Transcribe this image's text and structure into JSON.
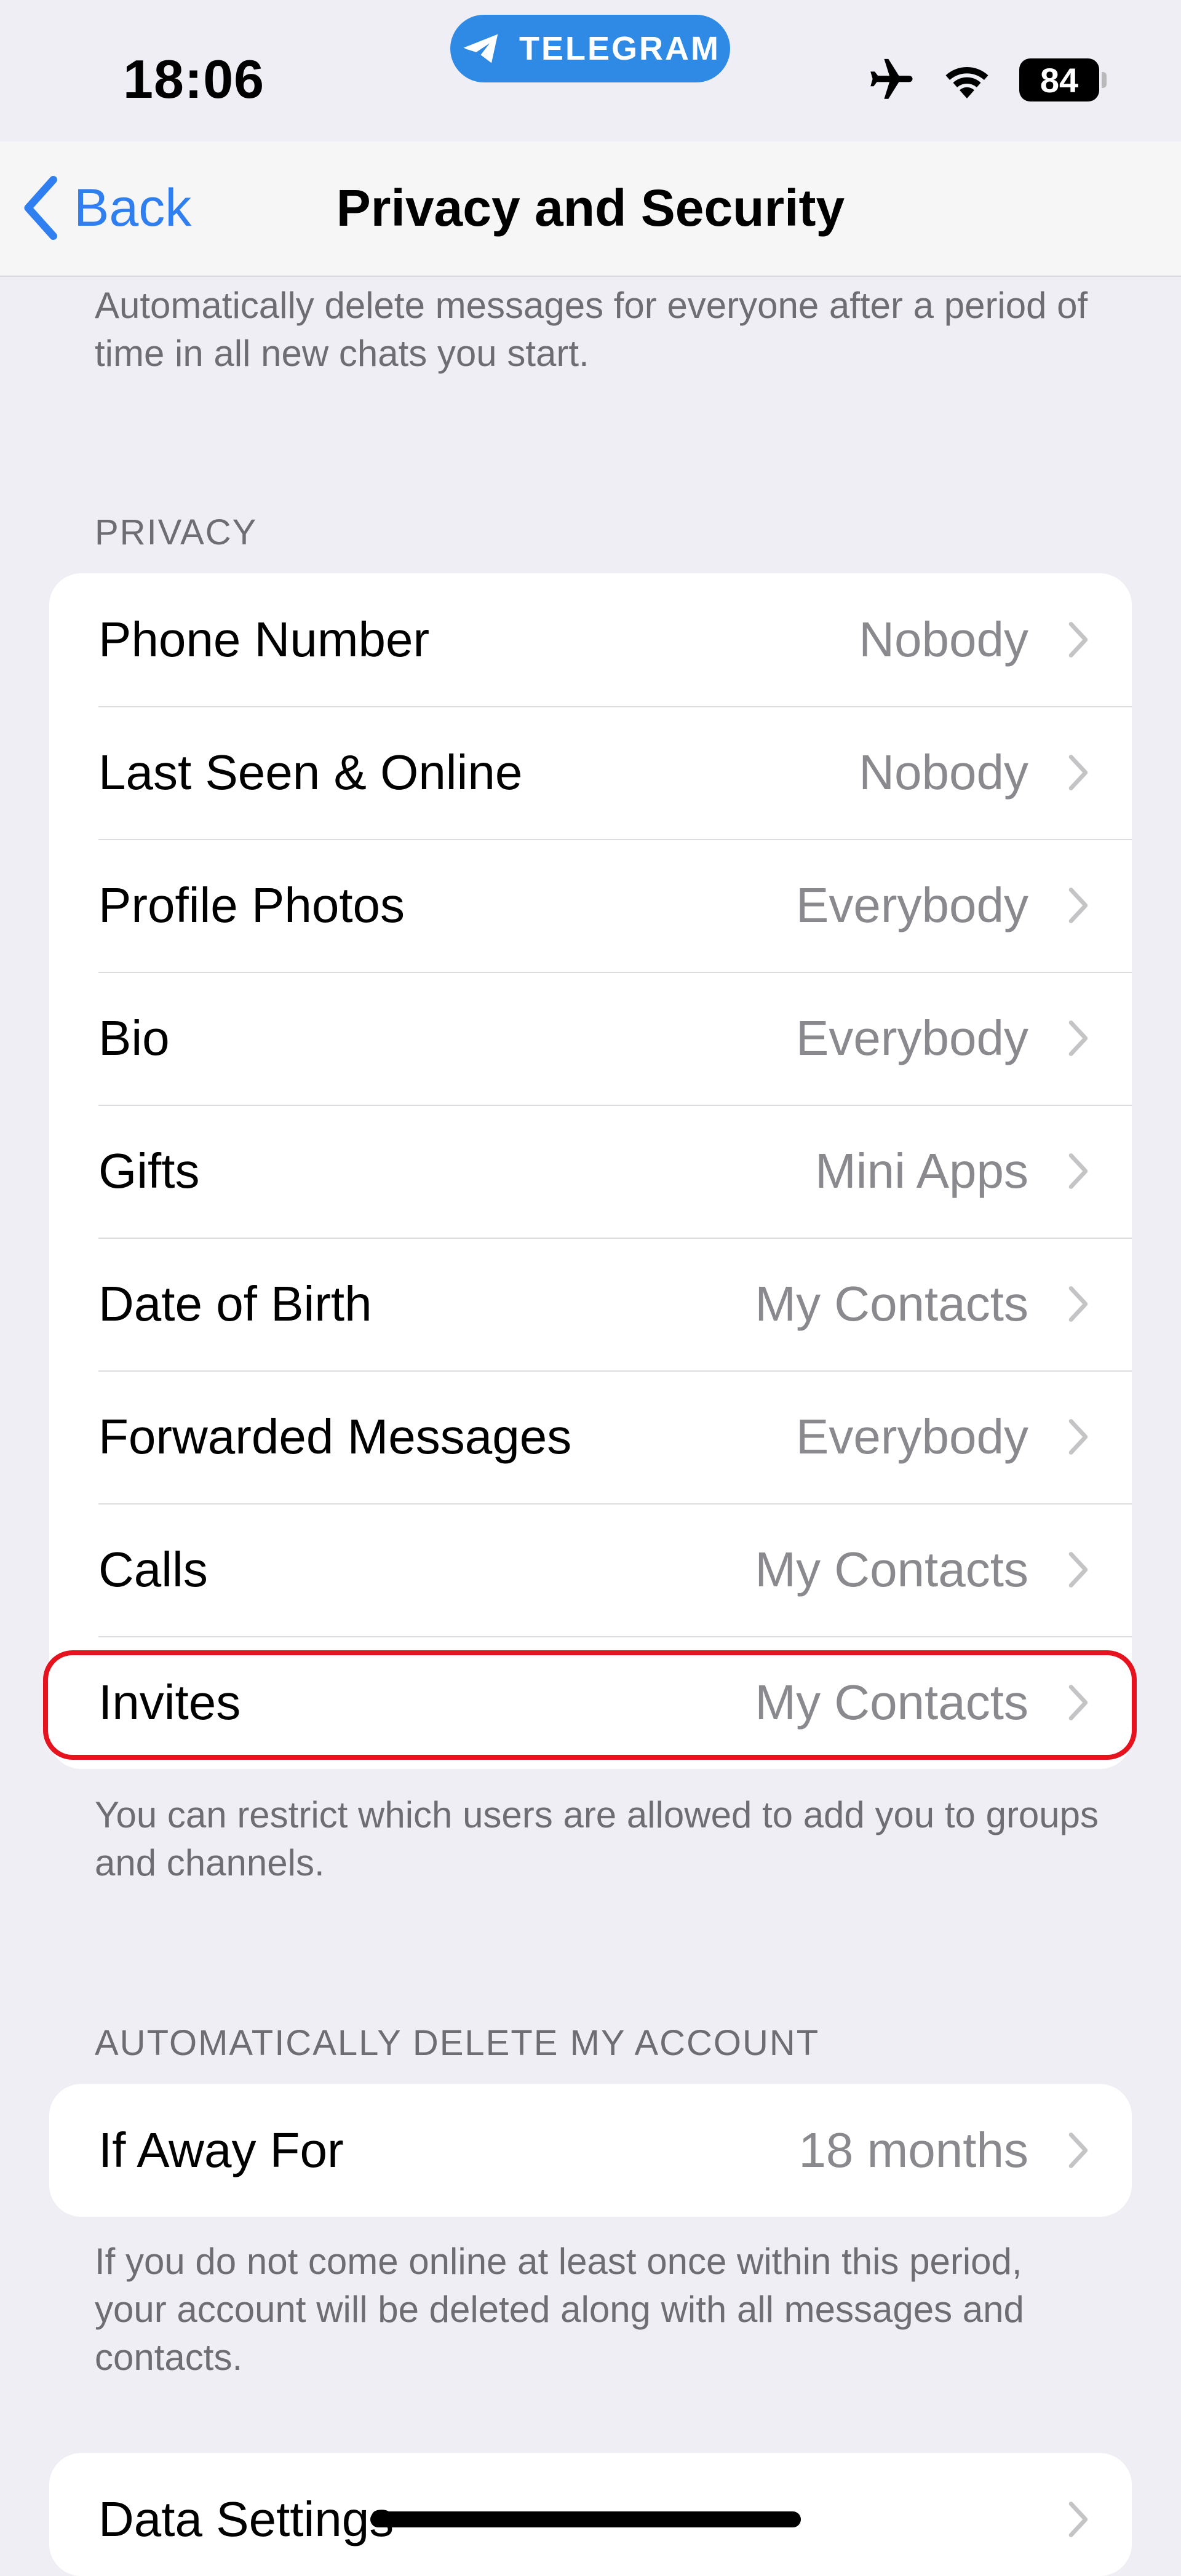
{
  "status_bar": {
    "time": "18:06",
    "app_pill": "TELEGRAM",
    "battery": "84",
    "icons": [
      "airplane-icon",
      "wifi-icon",
      "battery-icon"
    ]
  },
  "nav": {
    "back_label": "Back",
    "title": "Privacy and Security"
  },
  "top_footer": "Automatically delete messages for everyone after a period of time in all new chats you start.",
  "privacy": {
    "header": "PRIVACY",
    "rows": [
      {
        "label": "Phone Number",
        "value": "Nobody"
      },
      {
        "label": "Last Seen & Online",
        "value": "Nobody"
      },
      {
        "label": "Profile Photos",
        "value": "Everybody"
      },
      {
        "label": "Bio",
        "value": "Everybody"
      },
      {
        "label": "Gifts",
        "value": "Mini Apps"
      },
      {
        "label": "Date of Birth",
        "value": "My Contacts"
      },
      {
        "label": "Forwarded Messages",
        "value": "Everybody"
      },
      {
        "label": "Calls",
        "value": "My Contacts"
      },
      {
        "label": "Invites",
        "value": "My Contacts"
      }
    ],
    "footer": "You can restrict which users are allowed to add you to groups and channels."
  },
  "delete_account": {
    "header": "AUTOMATICALLY DELETE MY ACCOUNT",
    "row": {
      "label": "If Away For",
      "value": "18 months"
    },
    "footer": "If you do not come online at least once within this period, your account will be deleted along with all messages and contacts."
  },
  "data_settings": {
    "row": {
      "label": "Data Settings"
    }
  },
  "colors": {
    "accent": "#2f7ff0",
    "telegram_pill": "#2f8ae5",
    "highlight": "#e6121e",
    "background": "#efeef4"
  }
}
